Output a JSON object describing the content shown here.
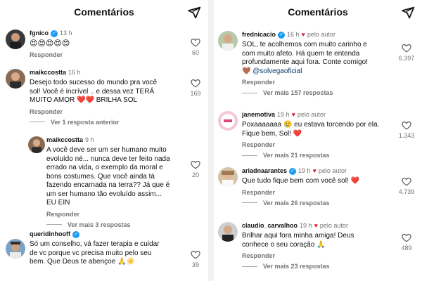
{
  "left": {
    "header_title": "Comentários",
    "comments": [
      {
        "username": "fgnico",
        "verified": true,
        "time": "13 h",
        "text": "😍😍😍😍😍",
        "reply_label": "Responder",
        "likes": "60"
      },
      {
        "username": "maikccostta",
        "verified": false,
        "time": "16 h",
        "text_lines": [
          "Desejo todo sucesso do mundo pra você",
          "sol! Você é incrível .. e dessa vez TERÁ",
          "MUITO AMOR ❤️❤️ BRILHA SOL"
        ],
        "reply_label": "Responder",
        "more_label": "Ver 1 resposta anterior",
        "likes": "169"
      },
      {
        "username": "maikccostta",
        "verified": false,
        "time": "9 h",
        "text_lines": [
          "A você deve ser um ser humano muito",
          "evoluído né... nunca deve ter feito nada",
          "errado na vida, o exemplo da moral e",
          "bons   costumes. Que você ainda tá",
          "fazendo encarnada na terra?? Já que é",
          "um ser humano tão evoluído assim...",
          "EU EIN"
        ],
        "reply_label": "Responder",
        "more_label": "Ver mais 3 respostas",
        "likes": "20"
      },
      {
        "username": "queridinhooff",
        "verified": true,
        "time": "",
        "text_lines": [
          "Só um conselho, vá fazer terapia e cuidar",
          "de vc porque vc precisa muito pelo seu",
          "bem. Que Deus te abençoe 🙏☀️"
        ],
        "likes": "39"
      }
    ]
  },
  "right": {
    "header_title": "Comentários",
    "comments": [
      {
        "username": "frednicacio",
        "verified": true,
        "time": "16 h",
        "author_label": "pelo autor",
        "text_lines": [
          "SOL, te acolhemos com muito carinho e",
          "com muito afeto. Há quem te entenda",
          "profundamente aqui fora. Conte comigo!",
          "🤎 @solvegaoficial"
        ],
        "reply_label": "Responder",
        "more_label": "Ver mais 157 respostas",
        "likes": "6.397"
      },
      {
        "username": "janemotiva",
        "verified": false,
        "time": "19 h",
        "author_label": "pelo autor",
        "text_lines": [
          "Poxaaaaaaa 🥲 eu estava torcendo por ela.",
          "Fique bem, Sol! ❤️"
        ],
        "reply_label": "Responder",
        "more_label": "Ver mais 21 respostas",
        "likes": "1.343"
      },
      {
        "username": "ariadnaarantes",
        "verified": true,
        "time": "19 h",
        "author_label": "pelo autor",
        "text_lines": [
          "Que tudo fique bem com você sol! ❤️"
        ],
        "reply_label": "Responder",
        "more_label": "Ver mais 26 respostas",
        "likes": "4.739"
      },
      {
        "username": "claudio_carvalhoo",
        "verified": false,
        "time": "19 h",
        "author_label": "pelo autor",
        "text_lines": [
          "Brilhar aqui fora minha amiga! Deus",
          "conhece o seu coração 🙏"
        ],
        "reply_label": "Responder",
        "more_label": "Ver mais 23 respostas",
        "likes": "489"
      }
    ]
  },
  "icons": {
    "send": "send-icon",
    "like": "heart-outline-icon",
    "verified": "verified-badge-icon"
  },
  "colors": {
    "verified": "#1d9bf0",
    "author_heart": "#e01e37",
    "secondary_text": "#737373",
    "mention": "#00376b"
  }
}
